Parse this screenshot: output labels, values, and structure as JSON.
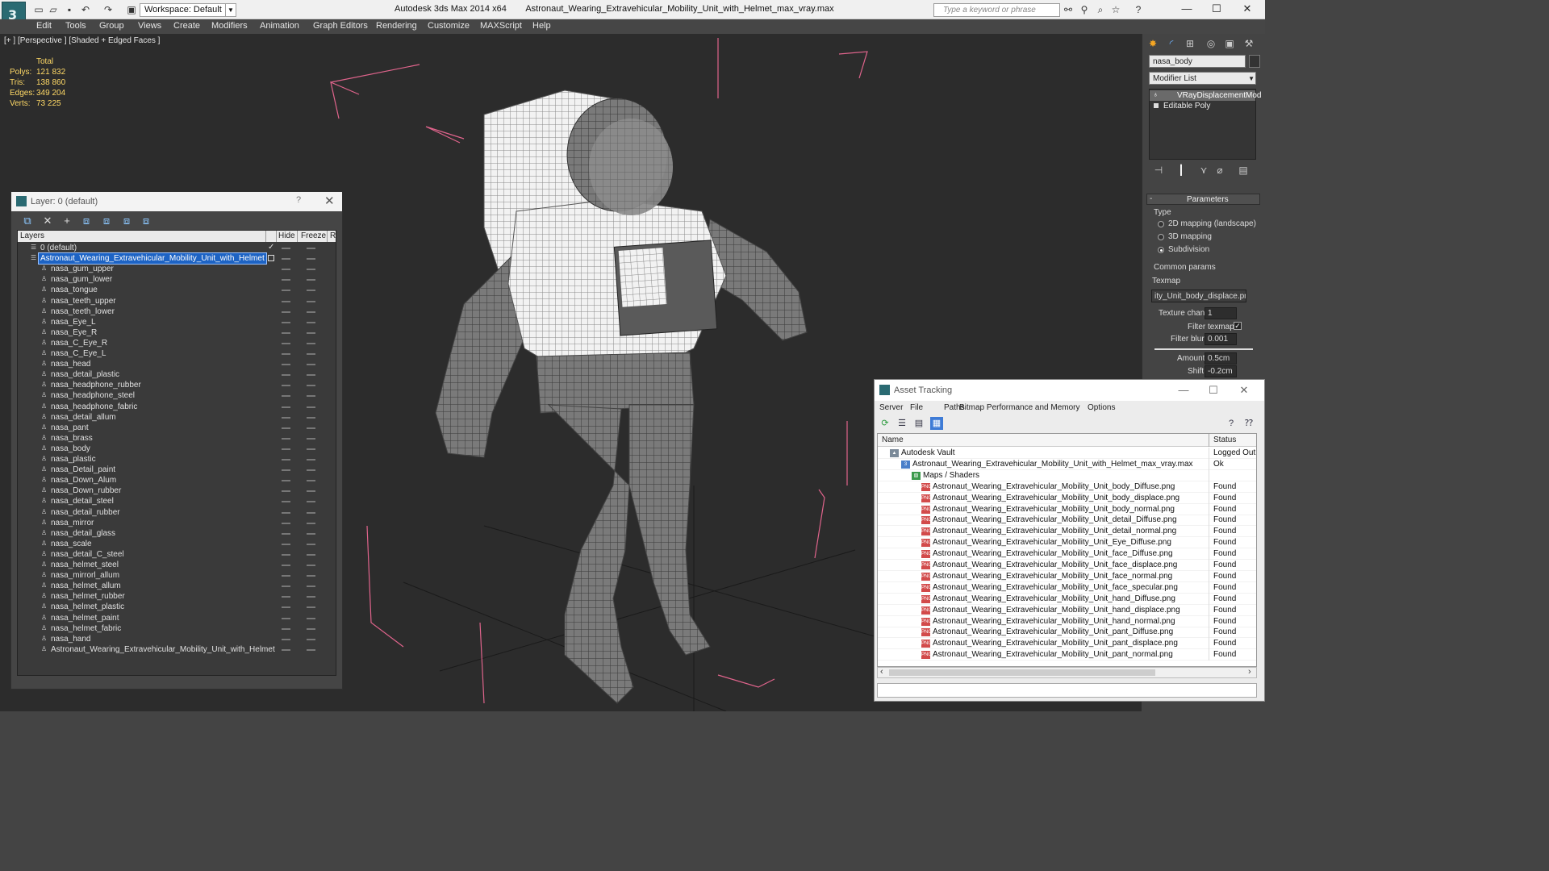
{
  "titlebar": {
    "workspace": "Workspace: Default",
    "app_name": "Autodesk 3ds Max  2014 x64",
    "file_name": "Astronaut_Wearing_Extravehicular_Mobility_Unit_with_Helmet_max_vray.max",
    "search_placeholder": "Type a keyword or phrase"
  },
  "menu": [
    "Edit",
    "Tools",
    "Group",
    "Views",
    "Create",
    "Modifiers",
    "Animation",
    "Graph Editors",
    "Rendering",
    "Customize",
    "MAXScript",
    "Help"
  ],
  "viewport": {
    "label": "[+ ] [Perspective ] [Shaded + Edged Faces ]",
    "stats": {
      "header": "Total",
      "rows": [
        {
          "k": "Polys:",
          "v": "121 832"
        },
        {
          "k": "Tris:",
          "v": "138 860"
        },
        {
          "k": "Edges:",
          "v": "349 204"
        },
        {
          "k": "Verts:",
          "v": "73 225"
        }
      ]
    }
  },
  "layer_dialog": {
    "title": "Layer: 0 (default)",
    "help": "?",
    "columns": {
      "layers": "Layers",
      "hide": "Hide",
      "freeze": "Freeze",
      "render": "R"
    },
    "rows": [
      {
        "name": "0 (default)",
        "level": 0,
        "checked": true
      },
      {
        "name": "Astronaut_Wearing_Extravehicular_Mobility_Unit_with_Helmet",
        "level": 0,
        "selected": true
      },
      {
        "name": "nasa_gum_upper",
        "level": 1
      },
      {
        "name": "nasa_gum_lower",
        "level": 1
      },
      {
        "name": "nasa_tongue",
        "level": 1
      },
      {
        "name": "nasa_teeth_upper",
        "level": 1
      },
      {
        "name": "nasa_teeth_lower",
        "level": 1
      },
      {
        "name": "nasa_Eye_L",
        "level": 1
      },
      {
        "name": "nasa_Eye_R",
        "level": 1
      },
      {
        "name": "nasa_C_Eye_R",
        "level": 1
      },
      {
        "name": "nasa_C_Eye_L",
        "level": 1
      },
      {
        "name": "nasa_head",
        "level": 1
      },
      {
        "name": "nasa_detail_plastic",
        "level": 1
      },
      {
        "name": "nasa_headphone_rubber",
        "level": 1
      },
      {
        "name": "nasa_headphone_steel",
        "level": 1
      },
      {
        "name": "nasa_headphone_fabric",
        "level": 1
      },
      {
        "name": "nasa_detail_allum",
        "level": 1
      },
      {
        "name": "nasa_pant",
        "level": 1
      },
      {
        "name": "nasa_brass",
        "level": 1
      },
      {
        "name": "nasa_body",
        "level": 1
      },
      {
        "name": "nasa_plastic",
        "level": 1
      },
      {
        "name": "nasa_Detail_paint",
        "level": 1
      },
      {
        "name": "nasa_Down_Alum",
        "level": 1
      },
      {
        "name": "nasa_Down_rubber",
        "level": 1
      },
      {
        "name": "nasa_detail_steel",
        "level": 1
      },
      {
        "name": "nasa_detail_rubber",
        "level": 1
      },
      {
        "name": "nasa_mirror",
        "level": 1
      },
      {
        "name": "nasa_detail_glass",
        "level": 1
      },
      {
        "name": "nasa_scale",
        "level": 1
      },
      {
        "name": "nasa_detail_C_steel",
        "level": 1
      },
      {
        "name": "nasa_helmet_steel",
        "level": 1
      },
      {
        "name": "nasa_mirrorl_allum",
        "level": 1
      },
      {
        "name": "nasa_helmet_allum",
        "level": 1
      },
      {
        "name": "nasa_helmet_rubber",
        "level": 1
      },
      {
        "name": "nasa_helmet_plastic",
        "level": 1
      },
      {
        "name": "nasa_helmet_paint",
        "level": 1
      },
      {
        "name": "nasa_helmet_fabric",
        "level": 1
      },
      {
        "name": "nasa_hand",
        "level": 1
      },
      {
        "name": "Astronaut_Wearing_Extravehicular_Mobility_Unit_with_Helmet",
        "level": 1
      }
    ]
  },
  "command_panel": {
    "object_name": "nasa_body",
    "modifier_list": "Modifier List",
    "stack": [
      "VRayDisplacementMod",
      "Editable Poly"
    ],
    "parameters_title": "Parameters",
    "type_label": "Type",
    "type_options": [
      "2D mapping (landscape)",
      "3D mapping",
      "Subdivision"
    ],
    "type_selected": 2,
    "common_params": "Common params",
    "texmap_label": "Texmap",
    "texmap_value": "ity_Unit_body_displace.png)",
    "texture_chan_label": "Texture chan",
    "texture_chan_value": "1",
    "filter_texmap_label": "Filter texmap",
    "filter_blur_label": "Filter blur",
    "filter_blur_value": "0.001",
    "amount_label": "Amount",
    "amount_value": "0.5cm",
    "shift_label": "Shift",
    "shift_value": "-0.2cm"
  },
  "asset_tracking": {
    "title": "Asset Tracking",
    "menu": [
      "Server",
      "File",
      "Paths",
      "Bitmap Performance and Memory",
      "Options"
    ],
    "columns": {
      "name": "Name",
      "status": "Status"
    },
    "rows": [
      {
        "name": "Autodesk Vault",
        "status": "Logged Out",
        "level": 0,
        "icon": "vault"
      },
      {
        "name": "Astronaut_Wearing_Extravehicular_Mobility_Unit_with_Helmet_max_vray.max",
        "status": "Ok",
        "level": 1,
        "icon": "file"
      },
      {
        "name": "Maps / Shaders",
        "status": "",
        "level": 2,
        "icon": "map"
      },
      {
        "name": "Astronaut_Wearing_Extravehicular_Mobility_Unit_body_Diffuse.png",
        "status": "Found",
        "level": 3,
        "icon": "png"
      },
      {
        "name": "Astronaut_Wearing_Extravehicular_Mobility_Unit_body_displace.png",
        "status": "Found",
        "level": 3,
        "icon": "png"
      },
      {
        "name": "Astronaut_Wearing_Extravehicular_Mobility_Unit_body_normal.png",
        "status": "Found",
        "level": 3,
        "icon": "png"
      },
      {
        "name": "Astronaut_Wearing_Extravehicular_Mobility_Unit_detail_Diffuse.png",
        "status": "Found",
        "level": 3,
        "icon": "png"
      },
      {
        "name": "Astronaut_Wearing_Extravehicular_Mobility_Unit_detail_normal.png",
        "status": "Found",
        "level": 3,
        "icon": "png"
      },
      {
        "name": "Astronaut_Wearing_Extravehicular_Mobility_Unit_Eye_Diffuse.png",
        "status": "Found",
        "level": 3,
        "icon": "png"
      },
      {
        "name": "Astronaut_Wearing_Extravehicular_Mobility_Unit_face_Diffuse.png",
        "status": "Found",
        "level": 3,
        "icon": "png"
      },
      {
        "name": "Astronaut_Wearing_Extravehicular_Mobility_Unit_face_displace.png",
        "status": "Found",
        "level": 3,
        "icon": "png"
      },
      {
        "name": "Astronaut_Wearing_Extravehicular_Mobility_Unit_face_normal.png",
        "status": "Found",
        "level": 3,
        "icon": "png"
      },
      {
        "name": "Astronaut_Wearing_Extravehicular_Mobility_Unit_face_specular.png",
        "status": "Found",
        "level": 3,
        "icon": "png"
      },
      {
        "name": "Astronaut_Wearing_Extravehicular_Mobility_Unit_hand_Diffuse.png",
        "status": "Found",
        "level": 3,
        "icon": "png"
      },
      {
        "name": "Astronaut_Wearing_Extravehicular_Mobility_Unit_hand_displace.png",
        "status": "Found",
        "level": 3,
        "icon": "png"
      },
      {
        "name": "Astronaut_Wearing_Extravehicular_Mobility_Unit_hand_normal.png",
        "status": "Found",
        "level": 3,
        "icon": "png"
      },
      {
        "name": "Astronaut_Wearing_Extravehicular_Mobility_Unit_pant_Diffuse.png",
        "status": "Found",
        "level": 3,
        "icon": "png"
      },
      {
        "name": "Astronaut_Wearing_Extravehicular_Mobility_Unit_pant_displace.png",
        "status": "Found",
        "level": 3,
        "icon": "png"
      },
      {
        "name": "Astronaut_Wearing_Extravehicular_Mobility_Unit_pant_normal.png",
        "status": "Found",
        "level": 3,
        "icon": "png"
      }
    ]
  },
  "colors": {
    "selection": "#1d63c4",
    "stats": "#ffd966",
    "bbox_lines": "#e0648c",
    "viewport_bg": "#2c2c2c"
  }
}
